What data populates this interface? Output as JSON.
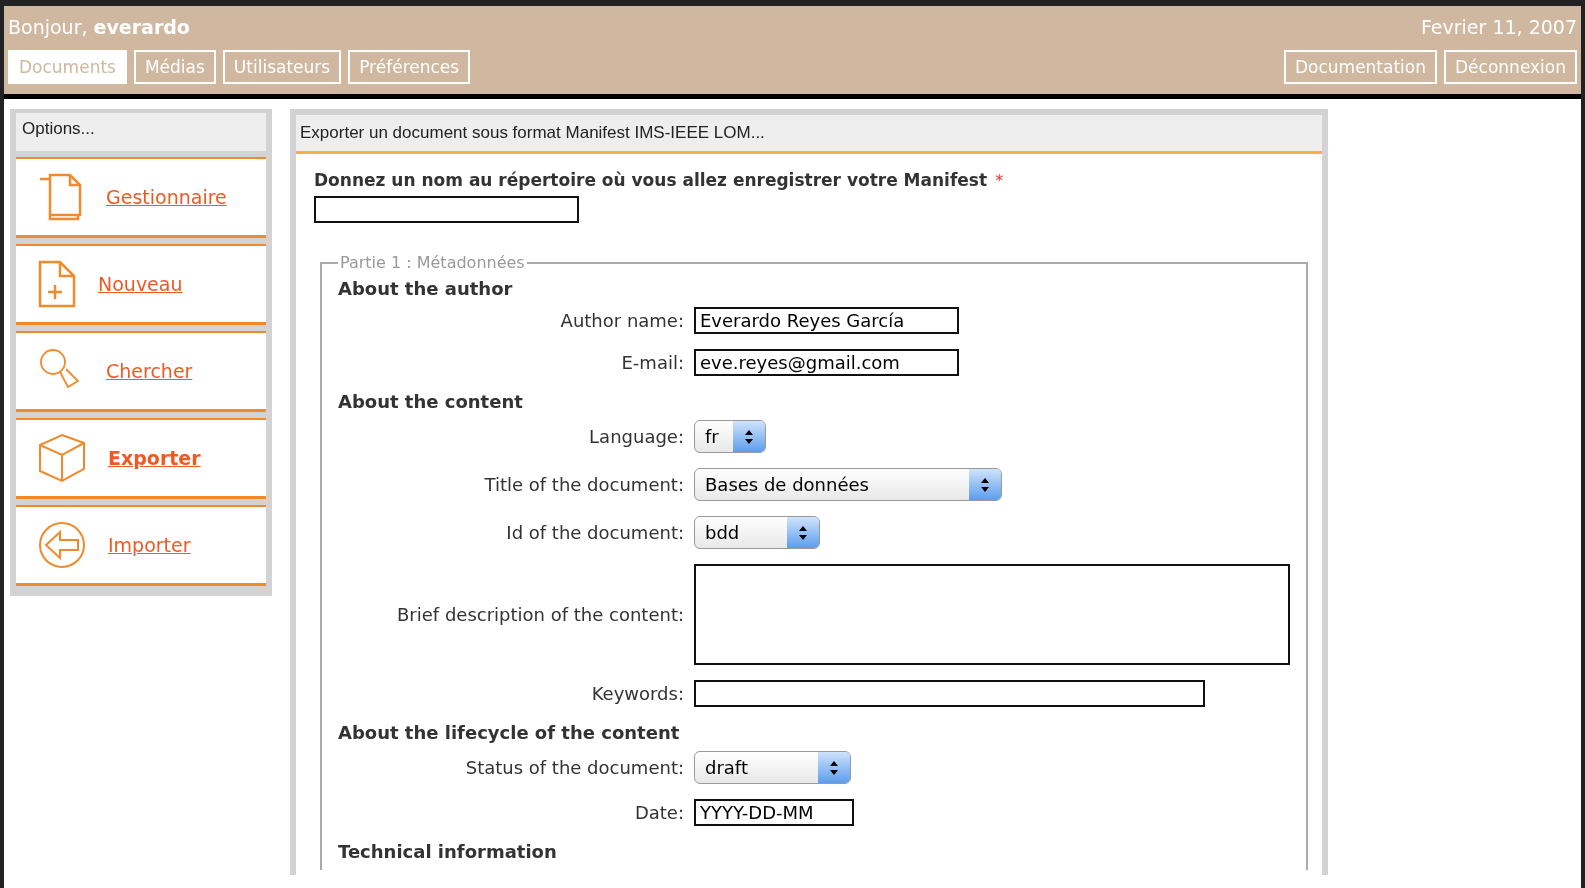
{
  "header": {
    "greeting": "Bonjour, **everardo**",
    "date": "Fevrier 11, 2007",
    "tabs": [
      {
        "label": "Documents",
        "selected": true
      },
      {
        "label": "Médias",
        "selected": false
      },
      {
        "label": "Utilisateurs",
        "selected": false
      },
      {
        "label": "Préférences",
        "selected": false
      }
    ],
    "links": [
      "Documentation",
      "Déconnexion"
    ]
  },
  "sidebar": {
    "title": "Options...",
    "items": [
      {
        "label": "Gestionnaire",
        "selected": false
      },
      {
        "label": "Nouveau",
        "selected": false
      },
      {
        "label": "Chercher",
        "selected": false
      },
      {
        "label": "Exporter",
        "selected": true
      },
      {
        "label": "Importer",
        "selected": false
      }
    ]
  },
  "panel": {
    "title": "Exporter un document sous format Manifest IMS-IEEE LOM...",
    "prompt": "Donnez un nom au répertoire où vous allez enregistrer votre Manifest",
    "required_mark": "*",
    "fieldset": {
      "legend": "Partie 1 : Métadonnées",
      "sections": [
        {
          "heading": "About the author",
          "fields": [
            {
              "label": "Author name:",
              "kind": "text",
              "value": "Everardo Reyes García"
            },
            {
              "label": "E-mail:",
              "kind": "text",
              "value": "eve.reyes@gmail.com"
            }
          ]
        },
        {
          "heading": "About the content",
          "fields": [
            {
              "label": "Language:",
              "kind": "select",
              "value": "fr"
            },
            {
              "label": "Title of the document:",
              "kind": "select",
              "value": "Bases de données"
            },
            {
              "label": "Id of the document:",
              "kind": "select",
              "value": "bdd"
            },
            {
              "label": "Brief description of the content:",
              "kind": "textarea"
            },
            {
              "label": "Keywords:",
              "kind": "text"
            }
          ]
        },
        {
          "heading": "About the lifecycle of the content",
          "fields": [
            {
              "label": "Status of the document:",
              "kind": "select",
              "value": "draft"
            },
            {
              "label": "Date:",
              "kind": "text",
              "value": "YYYY-DD-MM"
            }
          ]
        },
        {
          "heading": "Technical information"
        }
      ]
    }
  }
}
